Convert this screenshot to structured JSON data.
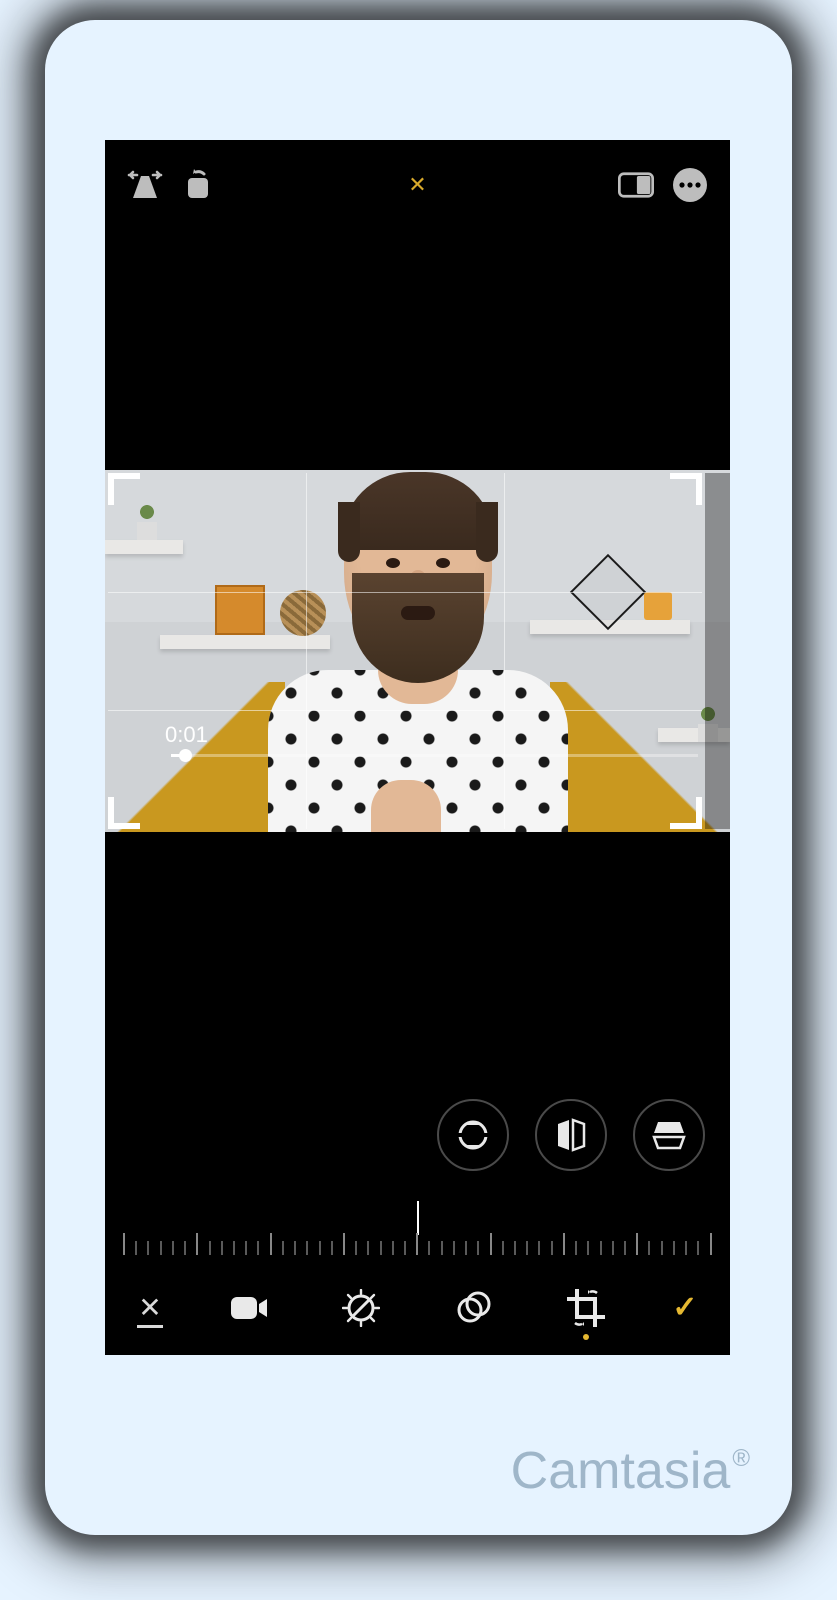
{
  "toolbar": {
    "perspective_icon": "perspective-icon",
    "rotate_icon": "rotate-icon",
    "close_label": "✕",
    "aspect_icon": "aspect-ratio-icon",
    "more_icon": "more-icon"
  },
  "preview": {
    "timestamp": "0:01"
  },
  "geometry": {
    "straighten_icon": "straighten-icon",
    "vertical_icon": "flip-vertical-icon",
    "horizontal_icon": "flip-horizontal-icon"
  },
  "bottombar": {
    "cancel_label": "✕",
    "confirm_label": "✓",
    "tabs": {
      "video": "video-icon",
      "adjust": "adjust-icon",
      "filters": "filters-icon",
      "crop": "crop-icon"
    },
    "active_tab": "crop"
  },
  "watermark": {
    "text": "Camtasia",
    "mark": "®"
  }
}
